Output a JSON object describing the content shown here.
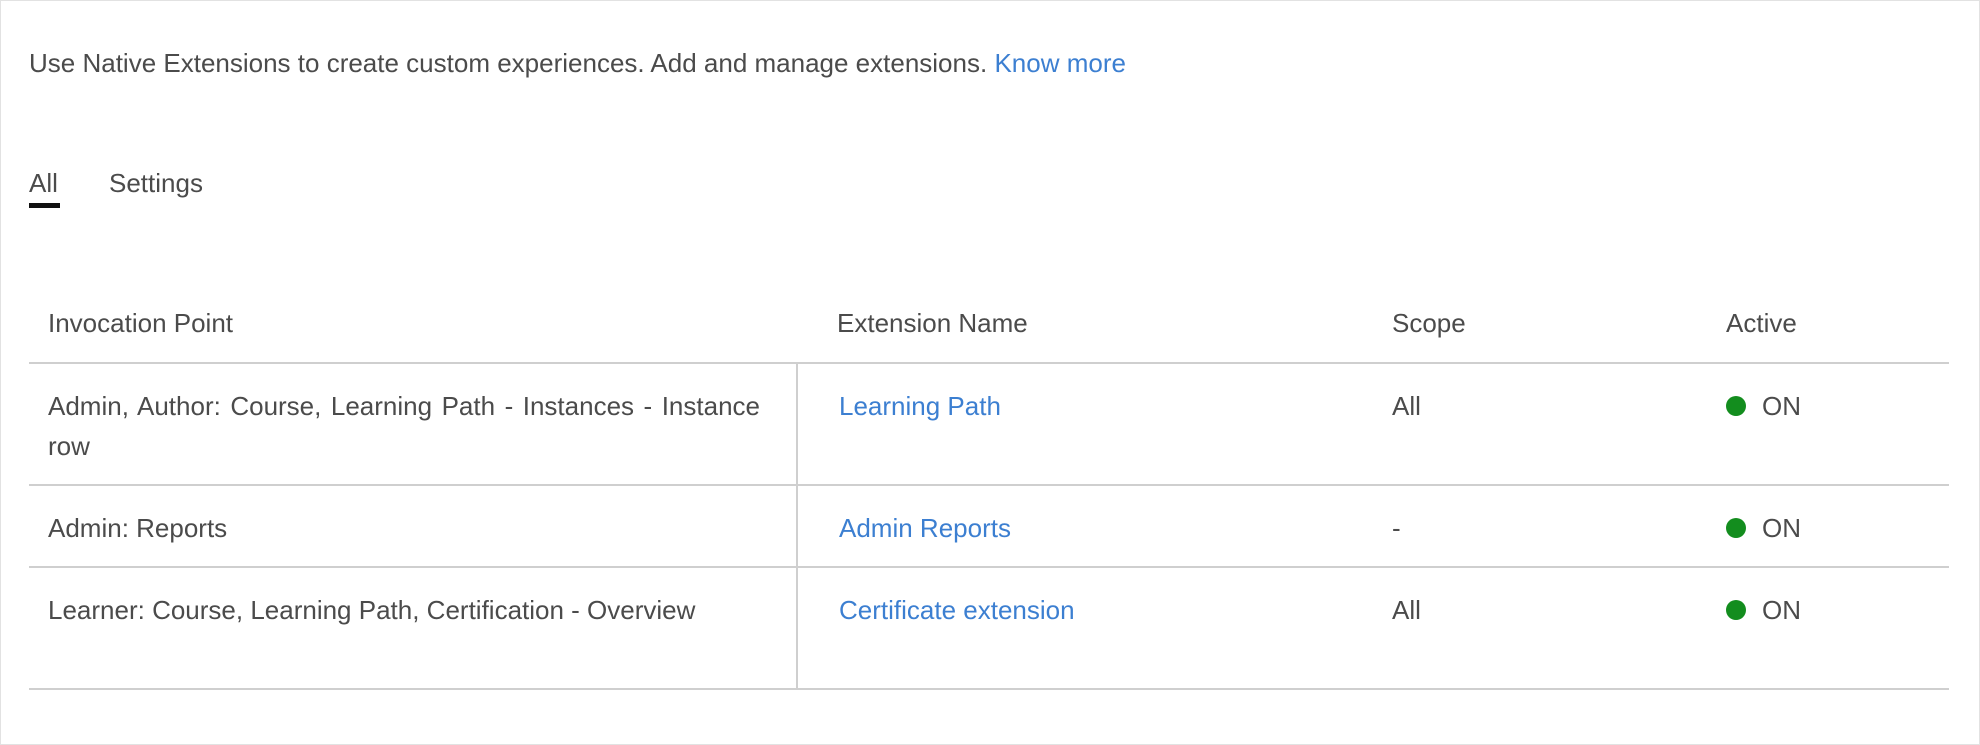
{
  "intro": {
    "text": "Use Native Extensions to create custom experiences. Add and manage extensions.",
    "link": "Know more"
  },
  "tabs": [
    {
      "label": "All",
      "selected": true
    },
    {
      "label": "Settings",
      "selected": false
    }
  ],
  "table": {
    "columns": [
      "Invocation Point",
      "Extension Name",
      "Scope",
      "Active"
    ],
    "rows": [
      {
        "invocation_point": "Admin, Author: Course, Learning Path - Instances - Instance row",
        "extension_name": "Learning Path",
        "scope": "All",
        "active": "ON"
      },
      {
        "invocation_point": "Admin: Reports",
        "extension_name": "Admin Reports",
        "scope": "-",
        "active": "ON"
      },
      {
        "invocation_point": "Learner: Course, Learning Path, Certification - Overview",
        "extension_name": "Certificate extension",
        "scope": "All",
        "active": "ON"
      }
    ]
  },
  "colors": {
    "link": "#3c7fd1",
    "active_dot": "#138d1e",
    "text": "#4b4b4b",
    "divider": "#cfcfcf"
  }
}
